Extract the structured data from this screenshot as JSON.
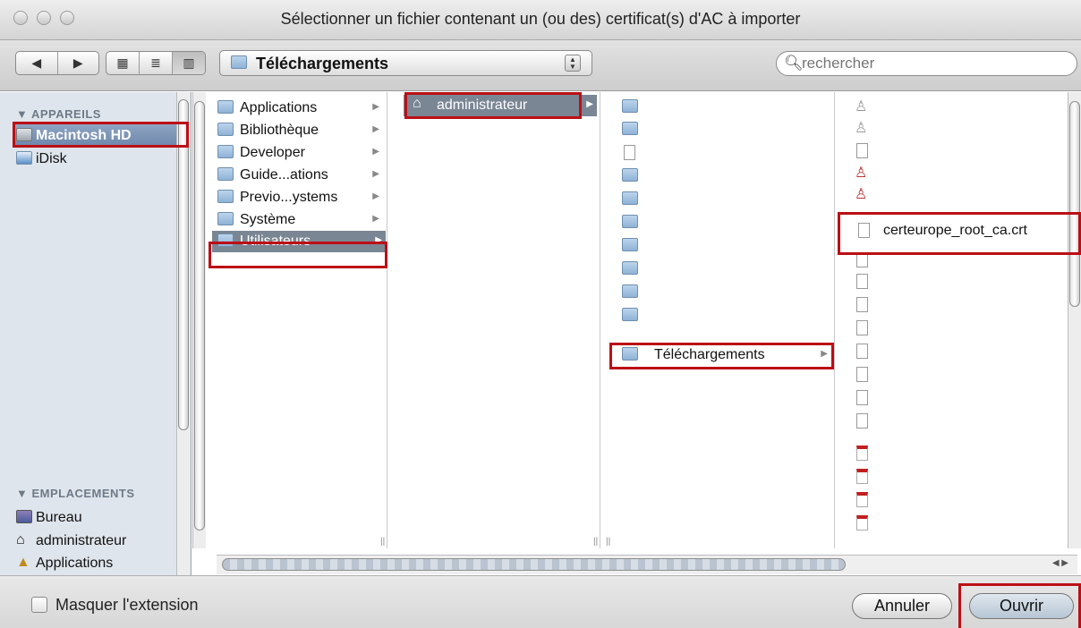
{
  "window": {
    "title": "Sélectionner un fichier contenant un (ou des) certificat(s) d'AC à importer"
  },
  "toolbar": {
    "back": "◀",
    "forward": "▶",
    "view_icon": "▦",
    "view_list": "≣",
    "view_columns": "▥",
    "path": "Téléchargements",
    "search_placeholder": "rechercher"
  },
  "sidebar": {
    "devices_heading": "▼ APPAREILS",
    "devices": [
      "Macintosh HD",
      "iDisk"
    ],
    "places_heading": "▼ EMPLACEMENTS",
    "places": [
      "Bureau",
      "administrateur",
      "Applications"
    ]
  },
  "columns": {
    "col1": [
      {
        "label": "Applications",
        "icon": "applications-folder-icon"
      },
      {
        "label": "Bibliothèque",
        "icon": "library-folder-icon"
      },
      {
        "label": "Developer",
        "icon": "folder-icon"
      },
      {
        "label": "Guide...ations",
        "icon": "folder-icon"
      },
      {
        "label": "Previo...ystems",
        "icon": "folder-icon"
      },
      {
        "label": "Système",
        "icon": "system-folder-icon"
      },
      {
        "label": "Utilisateurs",
        "icon": "users-folder-icon"
      }
    ],
    "col2": [
      {
        "label": "administrateur",
        "icon": "home-icon"
      }
    ],
    "col3_selected": "Téléchargements",
    "col4_selected": "certeurope_root_ca.crt"
  },
  "bottom": {
    "hide_extension": "Masquer l'extension",
    "cancel": "Annuler",
    "open": "Ouvrir"
  },
  "colors": {
    "highlight_box": "#bb0f15",
    "selection": "#7a8694",
    "sidebar_bg": "#dfe5ec"
  }
}
